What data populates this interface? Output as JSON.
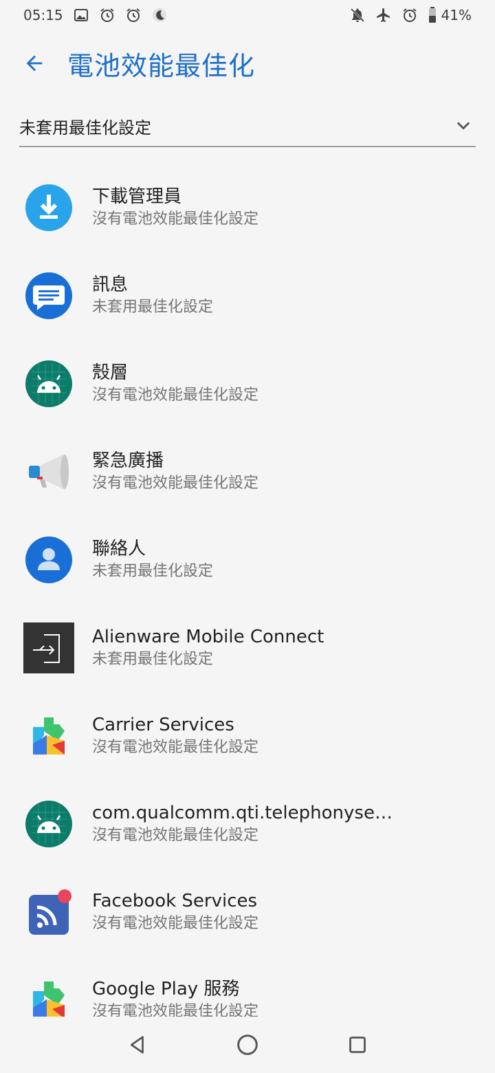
{
  "status_bar": {
    "time": "05:15",
    "battery": "41%",
    "left_icons": [
      "image-icon",
      "alarm-icon",
      "alarm-icon",
      "do-not-disturb-moon-icon"
    ],
    "right_icons": [
      "notifications-off-icon",
      "airplane-mode-icon",
      "alarm-icon",
      "battery-icon"
    ]
  },
  "app_bar": {
    "title": "電池效能最佳化",
    "back_icon": "arrow-back-icon",
    "accent_color": "#1e6fc9"
  },
  "filter": {
    "selected": "未套用最佳化設定",
    "icon": "chevron-down-icon"
  },
  "apps": [
    {
      "name": "下載管理員",
      "status": "沒有電池效能最佳化設定",
      "icon": "download-manager-icon"
    },
    {
      "name": "訊息",
      "status": "未套用最佳化設定",
      "icon": "messages-icon"
    },
    {
      "name": "殼層",
      "status": "沒有電池效能最佳化設定",
      "icon": "android-icon"
    },
    {
      "name": "緊急廣播",
      "status": "沒有電池效能最佳化設定",
      "icon": "megaphone-icon"
    },
    {
      "name": "聯絡人",
      "status": "未套用最佳化設定",
      "icon": "contacts-icon"
    },
    {
      "name": "Alienware Mobile Connect",
      "status": "未套用最佳化設定",
      "icon": "alienware-connect-icon"
    },
    {
      "name": "Carrier Services",
      "status": "沒有電池效能最佳化設定",
      "icon": "play-services-icon"
    },
    {
      "name": "com.qualcomm.qti.telephonyservi..",
      "status": "沒有電池效能最佳化設定",
      "icon": "android-icon"
    },
    {
      "name": "Facebook Services",
      "status": "沒有電池效能最佳化設定",
      "icon": "facebook-services-icon"
    },
    {
      "name": "Google Play 服務",
      "status": "沒有電池效能最佳化設定",
      "icon": "play-services-icon"
    }
  ],
  "nav_bar": {
    "buttons": [
      "back-triangle-icon",
      "home-circle-icon",
      "recents-square-icon"
    ]
  }
}
